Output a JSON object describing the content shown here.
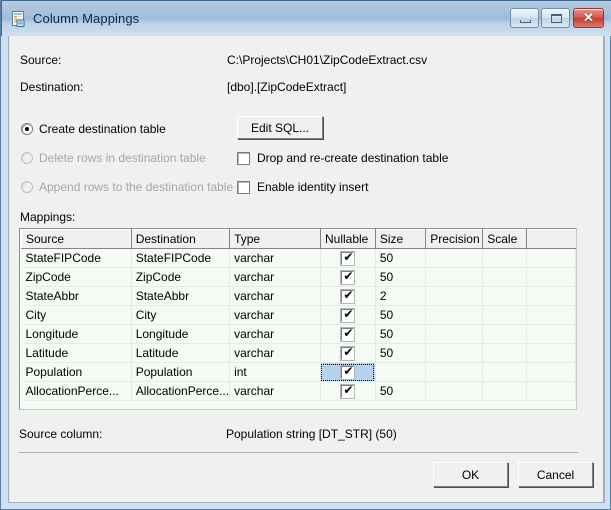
{
  "window": {
    "title": "Column Mappings",
    "icon": "column-mappings-icon",
    "controls": {
      "minimize": "–",
      "maximize": "□",
      "close": "✕"
    },
    "accent_color": "#a5c0d9",
    "close_color": "#c43d31"
  },
  "info": {
    "source_label": "Source:",
    "source_value": "C:\\Projects\\CH01\\ZipCodeExtract.csv",
    "destination_label": "Destination:",
    "destination_value": "[dbo].[ZipCodeExtract]"
  },
  "options": {
    "radios": [
      {
        "label": "Create destination table",
        "selected": true,
        "disabled": false
      },
      {
        "label": "Delete rows in destination table",
        "selected": false,
        "disabled": true
      },
      {
        "label": "Append rows to the destination table",
        "selected": false,
        "disabled": true
      }
    ],
    "checkboxes": [
      {
        "label": "Drop and re-create destination table",
        "checked": false
      },
      {
        "label": "Enable identity insert",
        "checked": false
      }
    ],
    "edit_sql_button": "Edit SQL..."
  },
  "mappings": {
    "label": "Mappings:",
    "columns": [
      "Source",
      "Destination",
      "Type",
      "Nullable",
      "Size",
      "Precision",
      "Scale"
    ],
    "rows": [
      {
        "source": "StateFIPCode",
        "destination": "StateFIPCode",
        "type": "varchar",
        "nullable": true,
        "size": "50",
        "precision": "",
        "scale": "",
        "selected": false
      },
      {
        "source": "ZipCode",
        "destination": "ZipCode",
        "type": "varchar",
        "nullable": true,
        "size": "50",
        "precision": "",
        "scale": "",
        "selected": false
      },
      {
        "source": "StateAbbr",
        "destination": "StateAbbr",
        "type": "varchar",
        "nullable": true,
        "size": "2",
        "precision": "",
        "scale": "",
        "selected": false
      },
      {
        "source": "City",
        "destination": "City",
        "type": "varchar",
        "nullable": true,
        "size": "50",
        "precision": "",
        "scale": "",
        "selected": false
      },
      {
        "source": "Longitude",
        "destination": "Longitude",
        "type": "varchar",
        "nullable": true,
        "size": "50",
        "precision": "",
        "scale": "",
        "selected": false
      },
      {
        "source": "Latitude",
        "destination": "Latitude",
        "type": "varchar",
        "nullable": true,
        "size": "50",
        "precision": "",
        "scale": "",
        "selected": false
      },
      {
        "source": "Population",
        "destination": "Population",
        "type": "int",
        "nullable": true,
        "size": "",
        "precision": "",
        "scale": "",
        "selected": true
      },
      {
        "source": "AllocationPerce...",
        "destination": "AllocationPerce...",
        "type": "varchar",
        "nullable": true,
        "size": "50",
        "precision": "",
        "scale": "",
        "selected": false
      }
    ]
  },
  "footer": {
    "source_column_label": "Source column:",
    "source_column_value": "Population string [DT_STR] (50)",
    "ok_label": "OK",
    "cancel_label": "Cancel"
  }
}
